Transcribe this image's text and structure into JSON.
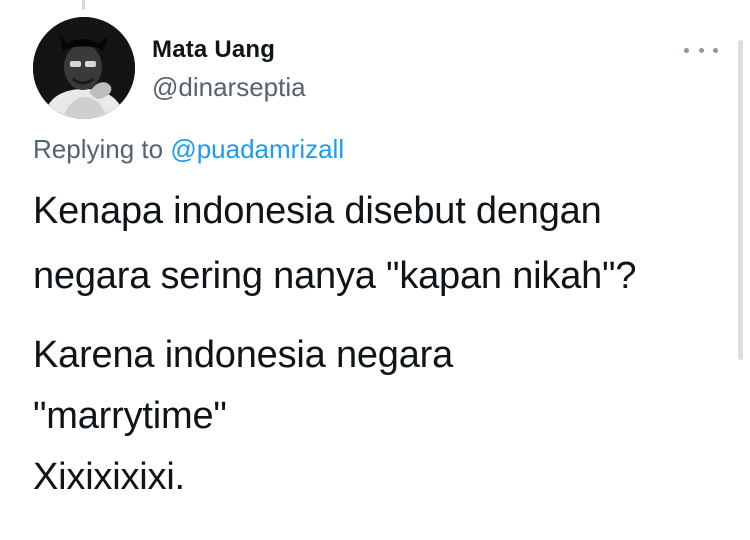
{
  "author": {
    "display_name": "Mata Uang",
    "handle": "@dinarseptia",
    "avatar_icon": "user-avatar"
  },
  "reply": {
    "prefix": "Replying to",
    "mention": "@puadamrizall"
  },
  "tweet": {
    "lines": [
      "Kenapa indonesia disebut dengan",
      "negara sering nanya \"kapan nikah\"?",
      "Karena indonesia negara",
      "\"marrytime\"",
      "Xixixixixi."
    ]
  },
  "more_icon": "more-horizontal-icon",
  "colors": {
    "text": "#0f1419",
    "secondary": "#536471",
    "link": "#1d9bf0"
  }
}
